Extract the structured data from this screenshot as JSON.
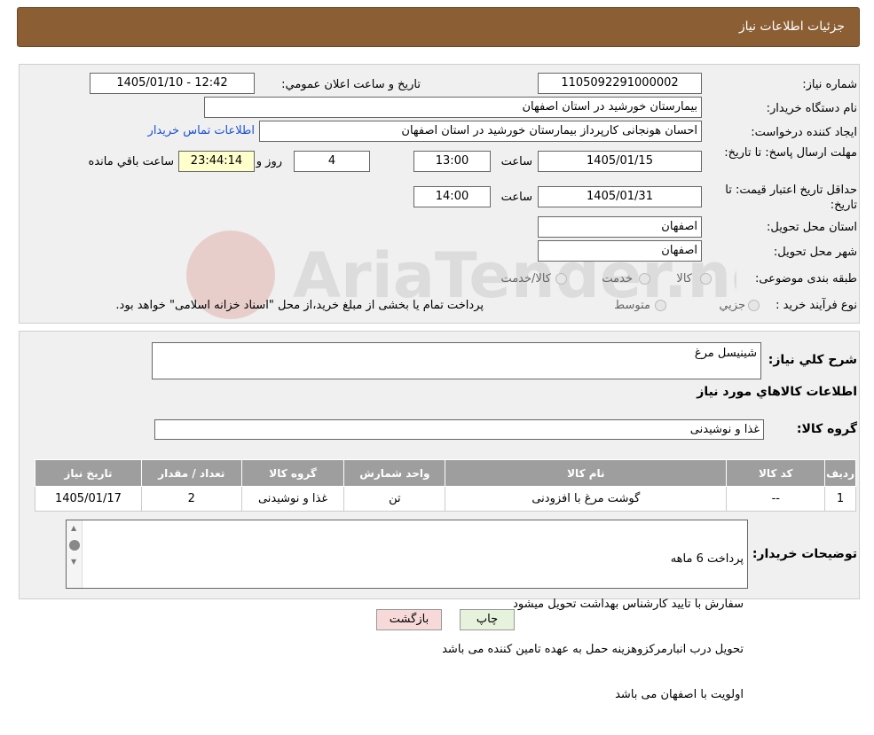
{
  "header": {
    "title": "جزئيات اطلاعات نياز"
  },
  "watermark": {
    "text": "AriaTender.neT"
  },
  "need": {
    "number_label": "شماره نياز:",
    "number_value": "1105092291000002",
    "announce_label": "تاريخ و ساعت اعلان عمومي:",
    "announce_value": "1405/01/10 - 12:42",
    "buyer_label": "نام دستگاه خريدار:",
    "buyer_value": "بيمارستان خورشيد در استان اصفهان",
    "creator_label": "ايجاد کننده درخواست:",
    "creator_value": "احسان هونجانی کارپرداز بیمارستان خورشید در استان اصفهان",
    "contact_link": "اطلاعات تماس خريدار",
    "deadline_label": "مهلت ارسال پاسخ: تا تاريخ:",
    "deadline_date": "1405/01/15",
    "time_label": "ساعت",
    "deadline_time": "13:00",
    "days_value": "4",
    "days_label": "روز و",
    "remaining_value": "23:44:14",
    "remaining_label": "ساعت باقي مانده",
    "validity_label": "حداقل تاريخ اعتبار قيمت: تا تاريخ:",
    "validity_date": "1405/01/31",
    "validity_time": "14:00",
    "province_label": "استان محل تحويل:",
    "province_value": "اصفهان",
    "city_label": "شهر محل تحويل:",
    "city_value": "اصفهان",
    "category_label": "طبقه بندی موضوعی:",
    "category_options": [
      "کالا",
      "خدمت",
      "کالا/خدمت"
    ],
    "process_label": "نوع فرآيند خريد :",
    "process_options": [
      "جزيي",
      "متوسط"
    ],
    "process_note": "پرداخت تمام يا بخشی از مبلغ خريد،از محل \"اسناد خزانه اسلامی\" خواهد بود."
  },
  "summary": {
    "label": "شرح کلي نياز:",
    "value": "شینیسل مرغ",
    "goods_info_title": "اطلاعات کالاهاي مورد نياز",
    "group_label": "گروه کالا:",
    "group_value": "غذا و نوشیدنی"
  },
  "table": {
    "headers": [
      "رديف",
      "کد کالا",
      "نام کالا",
      "واحد شمارش",
      "گروه کالا",
      "تعداد / مقدار",
      "تاريخ نياز"
    ],
    "rows": [
      [
        "1",
        "--",
        "گوشت مرغ با افزودنی",
        "تن",
        "غذا و نوشیدنی",
        "2",
        "1405/01/17"
      ]
    ]
  },
  "buyer_notes": {
    "label": "توضيحات خريدار:",
    "lines": [
      "پرداخت 6 ماهه",
      "سفارش با تایید کارشناس بهداشت تحویل میشود",
      "تحویل درب انبارمرکزوهزینه حمل به عهده تامین کننده می باشد",
      "اولویت با اصفهان می باشد"
    ]
  },
  "buttons": {
    "print": "چاپ",
    "back": "بازگشت"
  },
  "colors": {
    "header_bg": "#8b5e34",
    "back_button_bg": "#f7d9d9",
    "print_button_bg": "#e6f2dc",
    "remaining_bg": "#ffffcc"
  }
}
